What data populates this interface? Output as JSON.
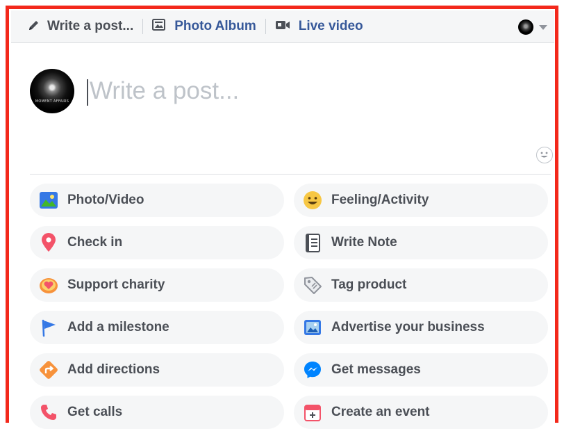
{
  "toolbar": {
    "tabs": [
      {
        "label": "Write a post...",
        "icon": "pencil-icon"
      },
      {
        "label": "Photo Album",
        "icon": "photo-album-icon"
      },
      {
        "label": "Live video",
        "icon": "video-camera-icon"
      }
    ],
    "account_menu": {
      "icon": "account-avatar",
      "caret": "chevron-down-icon"
    }
  },
  "composer": {
    "placeholder": "Write a post...",
    "avatar_brand": "MOMENT AFFAIRS",
    "emoji_icon": "smiley-face-icon"
  },
  "actions": [
    {
      "label": "Photo/Video",
      "icon": "photo-video-icon"
    },
    {
      "label": "Feeling/Activity",
      "icon": "feeling-emoji-icon"
    },
    {
      "label": "Check in",
      "icon": "location-pin-icon"
    },
    {
      "label": "Write Note",
      "icon": "notebook-icon"
    },
    {
      "label": "Support charity",
      "icon": "charity-heart-icon"
    },
    {
      "label": "Tag product",
      "icon": "price-tag-icon"
    },
    {
      "label": "Add a milestone",
      "icon": "flag-icon"
    },
    {
      "label": "Advertise your business",
      "icon": "advertise-icon"
    },
    {
      "label": "Add directions",
      "icon": "directions-icon"
    },
    {
      "label": "Get messages",
      "icon": "messenger-icon"
    },
    {
      "label": "Get calls",
      "icon": "phone-icon"
    },
    {
      "label": "Create an event",
      "icon": "calendar-event-icon"
    }
  ],
  "colors": {
    "frame_border": "#f3281b",
    "link_blue": "#365899",
    "label_gray": "#4b4f56",
    "pill_background": "#f5f6f7",
    "toolbar_background": "#f5f6f7"
  }
}
